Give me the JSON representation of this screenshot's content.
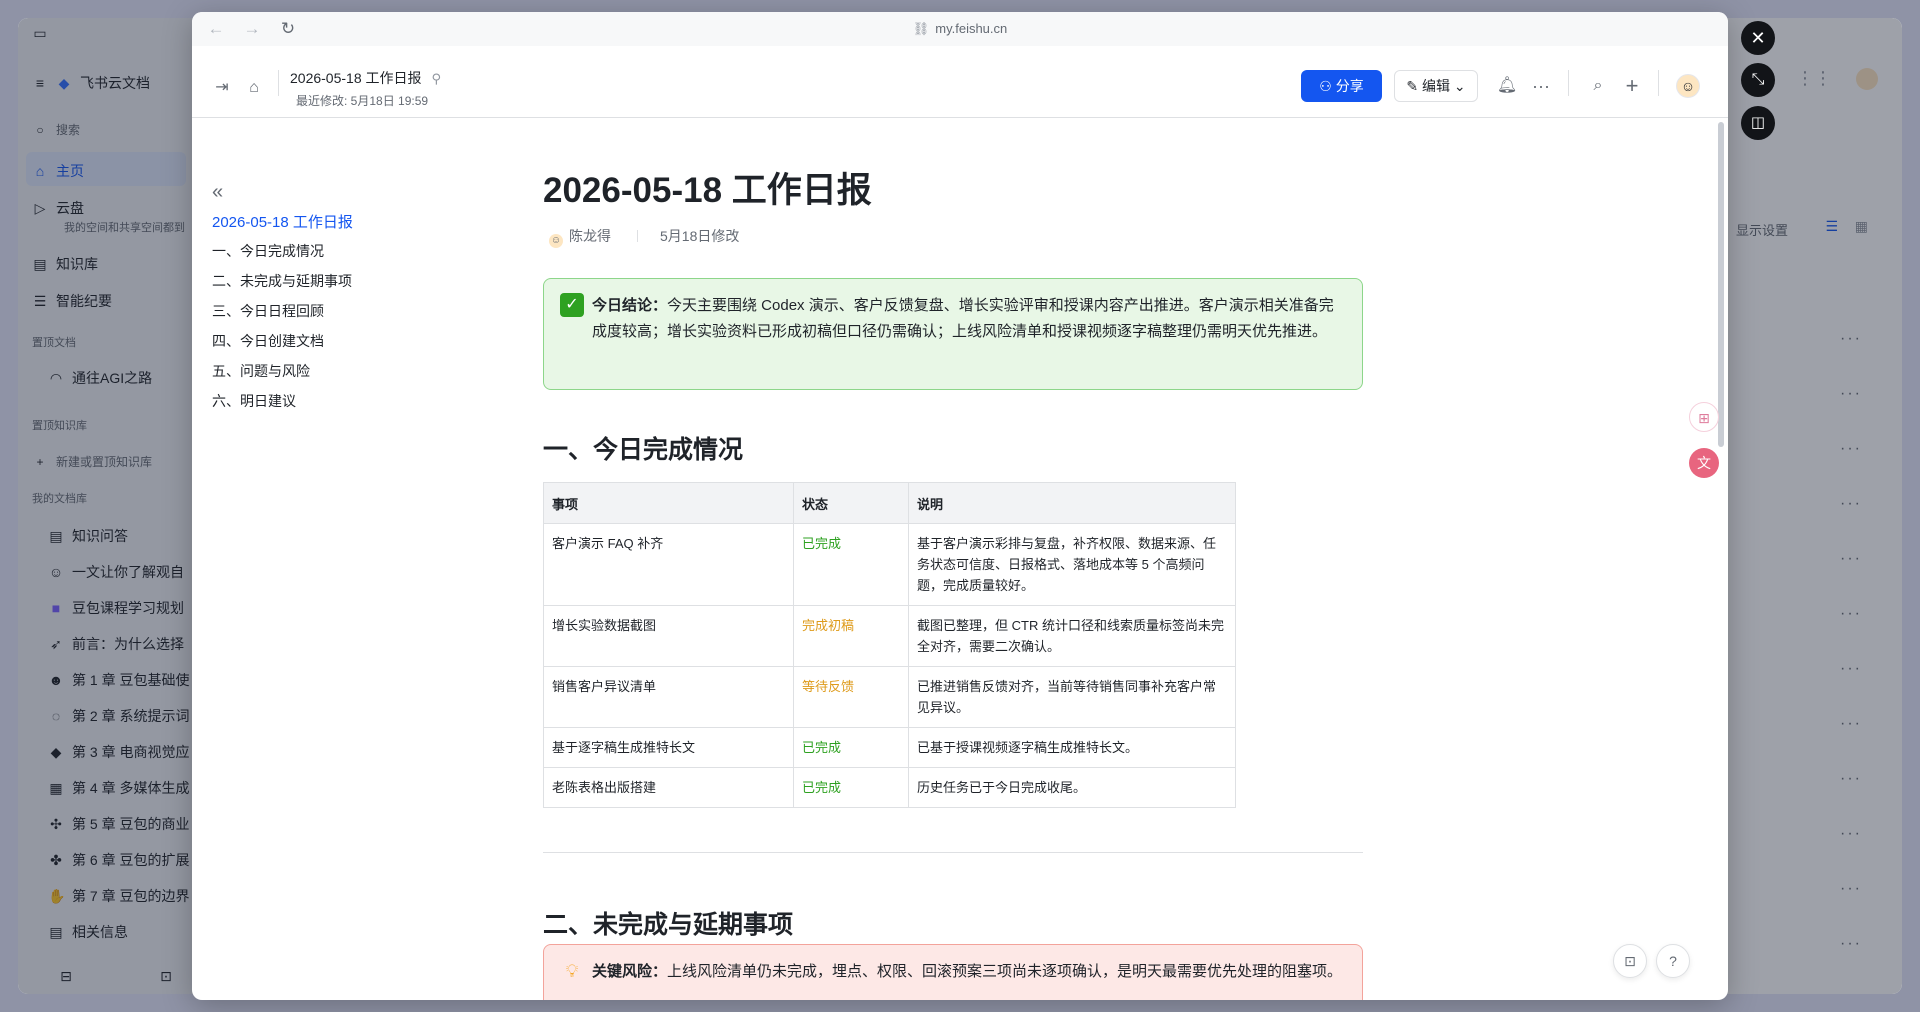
{
  "background_app": {
    "brand": "飞书云文档",
    "search": "搜索",
    "nav": [
      {
        "label": "主页",
        "icon": "home-icon"
      },
      {
        "label": "云盘",
        "icon": "cloud-drive-icon"
      },
      {
        "label": "我的空间和共享空间都到",
        "icon": ""
      },
      {
        "label": "知识库",
        "icon": "wiki-icon"
      },
      {
        "label": "智能纪要",
        "icon": "notes-icon"
      }
    ],
    "pinned_docs_title": "置顶文档",
    "pinned_doc": "通往AGI之路",
    "pinned_wiki_title": "置顶知识库",
    "new_pinned_wiki": "新建或置顶知识库",
    "my_library_title": "我的文档库",
    "library_items": [
      "知识问答",
      "一文让你了解观自",
      "豆包课程学习规划",
      "前言：为什么选择",
      "第 1 章 豆包基础使",
      "第 2 章 系统提示词",
      "第 3 章 电商视觉应",
      "第 4 章 多媒体生成",
      "第 5 章 豆包的商业",
      "第 6 章 豆包的扩展",
      "第 7 章 豆包的边界",
      "相关信息"
    ],
    "display_settings": "显示设置"
  },
  "browser": {
    "url": "my.feishu.cn"
  },
  "toolbar": {
    "doc_title": "2026-05-18 工作日报",
    "last_modified": "最近修改: 5月18日 19:59",
    "share_label": "分享",
    "edit_label": "编辑"
  },
  "outline": {
    "title": "2026-05-18 工作日报",
    "items": [
      "一、今日完成情况",
      "二、未完成与延期事项",
      "三、今日日程回顾",
      "四、今日创建文档",
      "五、问题与风险",
      "六、明日建议"
    ]
  },
  "document": {
    "title": "2026-05-18 工作日报",
    "author": "陈龙得",
    "modified": "5月18日修改",
    "conclusion_label": "今日结论：",
    "conclusion_text": "今天主要围绕 Codex 演示、客户反馈复盘、增长实验评审和授课内容产出推进。客户演示相关准备完成度较高；增长实验资料已形成初稿但口径仍需确认；上线风险清单和授课视频逐字稿整理仍需明天优先推进。",
    "section1_title": "一、今日完成情况",
    "table": {
      "headers": [
        "事项",
        "状态",
        "说明"
      ],
      "rows": [
        {
          "item": "客户演示 FAQ 补齐",
          "status": "已完成",
          "status_color": "#2ea121",
          "note": "基于客户演示彩排与复盘，补齐权限、数据来源、任务状态可信度、日报格式、落地成本等 5 个高频问题，完成质量较好。"
        },
        {
          "item": "增长实验数据截图",
          "status": "完成初稿",
          "status_color": "#de9b1b",
          "note": "截图已整理，但 CTR 统计口径和线索质量标签尚未完全对齐，需要二次确认。"
        },
        {
          "item": "销售客户异议清单",
          "status": "等待反馈",
          "status_color": "#de9b1b",
          "note": "已推进销售反馈对齐，当前等待销售同事补充客户常见异议。"
        },
        {
          "item": "基于逐字稿生成推特长文",
          "status": "已完成",
          "status_color": "#2ea121",
          "note": "已基于授课视频逐字稿生成推特长文。"
        },
        {
          "item": "老陈表格出版搭建",
          "status": "已完成",
          "status_color": "#2ea121",
          "note": "历史任务已于今日完成收尾。"
        }
      ]
    },
    "section2_title": "二、未完成与延期事项",
    "risk_label": "关键风险：",
    "risk_text": "上线风险清单仍未完成，埋点、权限、回滚预案三项尚未逐项确认，是明天最需要优先处理的阻塞项。"
  }
}
